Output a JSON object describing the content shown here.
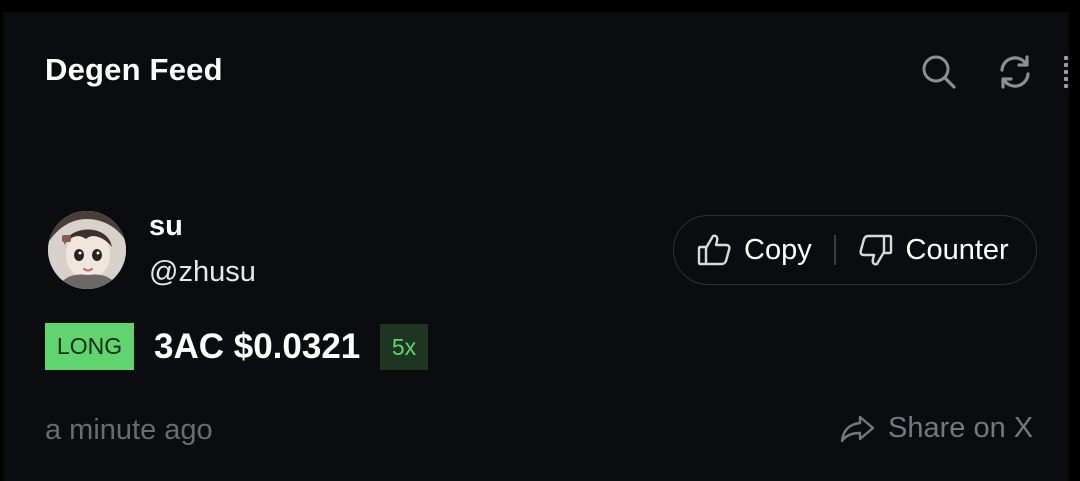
{
  "header": {
    "title": "Degen Feed",
    "search_icon": "search-icon",
    "refresh_icon": "refresh-icon"
  },
  "post": {
    "user": {
      "name": "su",
      "handle": "@zhusu",
      "avatar": "avatar-image"
    },
    "actions": {
      "copy_label": "Copy",
      "copy_icon": "thumbs-up-icon",
      "counter_label": "Counter",
      "counter_icon": "thumbs-down-icon"
    },
    "trade": {
      "side": "LONG",
      "text": "3AC $0.0321",
      "leverage": "5x"
    },
    "timestamp": "a minute ago",
    "share": {
      "label": "Share on X",
      "icon": "share-arrow-icon"
    }
  },
  "colors": {
    "background": "#0b0c0f",
    "long_badge": "#5fd46f",
    "leverage_badge_bg": "#1d3521",
    "leverage_text": "#62d46e",
    "muted_text": "#676b72"
  }
}
